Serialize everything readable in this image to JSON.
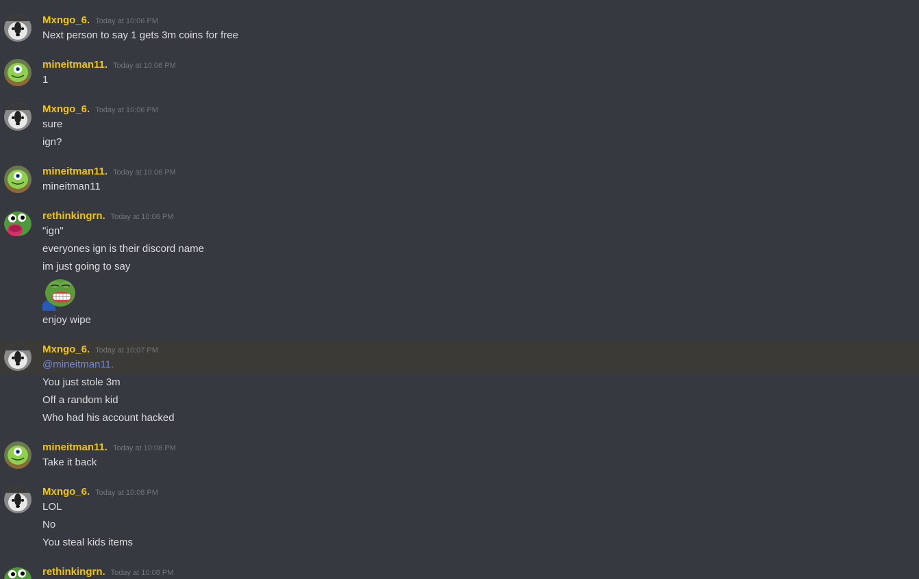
{
  "users": {
    "mxngo": {
      "name": "Mxngo_6.",
      "avatar": "dog-avatar-icon"
    },
    "mine": {
      "name": "mineitman11.",
      "avatar": "green-creature-avatar-icon"
    },
    "rethink": {
      "name": "rethinkingrn.",
      "avatar": "frog-avatar-icon"
    }
  },
  "colors": {
    "background": "#36393f",
    "username": "#f1c40f",
    "timestamp": "#72767d",
    "text": "#dcddde",
    "mention": "#7289da",
    "highlight": "#3b3a36"
  },
  "messages": [
    {
      "author": "Mxngo_6.",
      "time": "Today at 10:06 PM",
      "lines": [
        "Next person to say 1 gets 3m coins for free"
      ]
    },
    {
      "author": "mineitman11.",
      "time": "Today at 10:06 PM",
      "lines": [
        "1"
      ]
    },
    {
      "author": "Mxngo_6.",
      "time": "Today at 10:06 PM",
      "lines": [
        "sure",
        "ign?"
      ]
    },
    {
      "author": "mineitman11.",
      "time": "Today at 10:06 PM",
      "lines": [
        "mineitman11"
      ]
    },
    {
      "author": "rethinkingrn.",
      "time": "Today at 10:06 PM",
      "lines": [
        "\"ign\"",
        "everyones ign is their discord name",
        "im just going to say",
        "enjoy wipe"
      ],
      "emoji": "laughing-pepe-emoji"
    },
    {
      "author": "Mxngo_6.",
      "time": "Today at 10:07 PM",
      "mention": "@mineitman11.",
      "lines": [
        "You just stole 3m",
        "Off a random kid",
        "Who had his account hacked"
      ]
    },
    {
      "author": "mineitman11.",
      "time": "Today at 10:08 PM",
      "lines": [
        "Take it back"
      ]
    },
    {
      "author": "Mxngo_6.",
      "time": "Today at 10:08 PM",
      "lines": [
        "LOL",
        "No",
        "You steal kids items"
      ]
    },
    {
      "author": "rethinkingrn.",
      "time": "Today at 10:08 PM",
      "lines": []
    }
  ]
}
